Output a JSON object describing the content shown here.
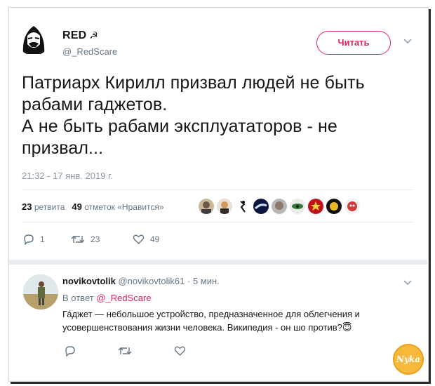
{
  "tweet": {
    "display_name": "RED",
    "name_symbol": "☭",
    "handle": "@_RedScare",
    "follow_label": "Читать",
    "text_lines": [
      "Патриарх Кирилл призвал людей не быть рабами гаджетов.",
      "А не быть рабами эксплуататоров - не призвал..."
    ],
    "timestamp": "21:32 - 17 янв. 2019 г.",
    "retweets_count": "23",
    "retweets_label": "ретвита",
    "likes_count": "49",
    "likes_label": "отметок «Нравится»",
    "actions": {
      "replies": "1",
      "retweets": "23",
      "likes": "49"
    }
  },
  "reply": {
    "display_name": "novikovtolik",
    "handle": "@novikovtolik61",
    "time": "5 мин.",
    "in_reply_prefix": "В ответ",
    "in_reply_to": "@_RedScare",
    "text": "Га́джет — небольшое устройство, предназначенное для облегчения и усовершенствования жизни человека. Википедия - он шо против?",
    "emoji": "😇"
  },
  "watermark": "Nyka",
  "colors": {
    "accent": "#e0245e",
    "secondary_text": "#657786",
    "border": "#e6ecf0"
  }
}
